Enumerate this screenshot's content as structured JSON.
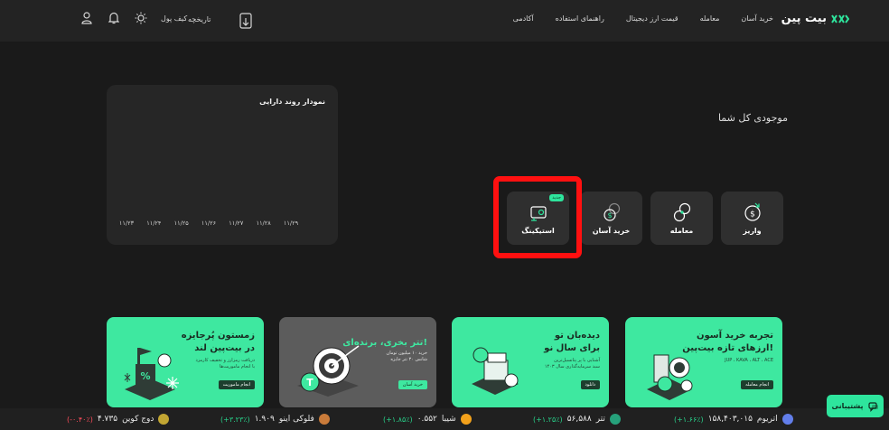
{
  "header": {
    "logo_text": "بیت پین",
    "nav": [
      "خرید آسان",
      "معامله",
      "قیمت ارز دیجیتال",
      "راهنمای استفاده",
      "آکادمی"
    ],
    "wallet_label": "کیف پول",
    "history_label": "تاریخچه"
  },
  "chart_card": {
    "title": "نمودار روند دارایی"
  },
  "chart_data": {
    "type": "line",
    "title": "نمودار روند دارایی",
    "categories": [
      "۱۱/۲۳",
      "۱۱/۲۴",
      "۱۱/۲۵",
      "۱۱/۲۶",
      "۱۱/۲۷",
      "۱۱/۲۸",
      "۱۱/۲۹"
    ],
    "series": [],
    "grid": false
  },
  "balance": {
    "title": "موجودی کل شما"
  },
  "actions": [
    {
      "label": "واریز",
      "icon": "deposit-icon"
    },
    {
      "label": "معامله",
      "icon": "trade-icon"
    },
    {
      "label": "خرید آسان",
      "icon": "easy-buy-icon"
    },
    {
      "label": "استیکینگ",
      "icon": "staking-icon",
      "badge": "جدید"
    }
  ],
  "banners": [
    {
      "title_1": "تجربه خرید آسون",
      "title_2": "ارزهای تازه بیت‌پین!",
      "sub_1": "JUP ، KAVA ، ALT ، ACE",
      "sub_2": "",
      "button": "انجام معامله",
      "bg": "#3ee8a0"
    },
    {
      "title_1": "دیده‌بان تو",
      "title_2": "برای سال نو",
      "sub_1": "آشنایی با پر پتانسیل‌ترین",
      "sub_2": "سبد سرمایه‌گذاری سال ۱۴۰۳",
      "button": "دانلود",
      "bg": "#3ee8a0"
    },
    {
      "title_1": "تتر بخری، برنده‌ای!",
      "title_2": "",
      "sub_1": "خرید ۱۰ میلیون تومان",
      "sub_2": "شانس ۳۰ تتر جایزه",
      "button": "خرید آسان",
      "bg": "#5c5c5c"
    },
    {
      "title_1": "زمستون پُرجایزه",
      "title_2": "در بیت‌پین لند",
      "sub_1": "دریافت رمزارز و تخفیف کارمزد",
      "sub_2": "با انجام ماموریت‌ها",
      "button": "انجام ماموریت",
      "bg": "#3ee8a0"
    }
  ],
  "ticker": [
    {
      "name": "اتریوم",
      "price": "۱۵۸,۴۰۳,۰۱۵",
      "change": "(+۱.۶۶٪)",
      "positive": true,
      "color": "#627eea"
    },
    {
      "name": "تتر",
      "price": "۵۶,۵۸۸",
      "change": "(+۱.۲۵٪)",
      "positive": true,
      "color": "#26a17b"
    },
    {
      "name": "شیبا",
      "price": "۰.۵۵۲",
      "change": "(+۱.۸۵٪)",
      "positive": true,
      "color": "#f2a11b"
    },
    {
      "name": "فلوکی اینو",
      "price": "۱.۹۰۹",
      "change": "(+۳.۲۳٪)",
      "positive": true,
      "color": "#c97b3a"
    },
    {
      "name": "دوج کوین",
      "price": "۴.۷۳۵",
      "change": "(-۰.۴۰٪)",
      "positive": false,
      "color": "#c2a633"
    }
  ],
  "support": {
    "label": "پشتیبانی"
  }
}
